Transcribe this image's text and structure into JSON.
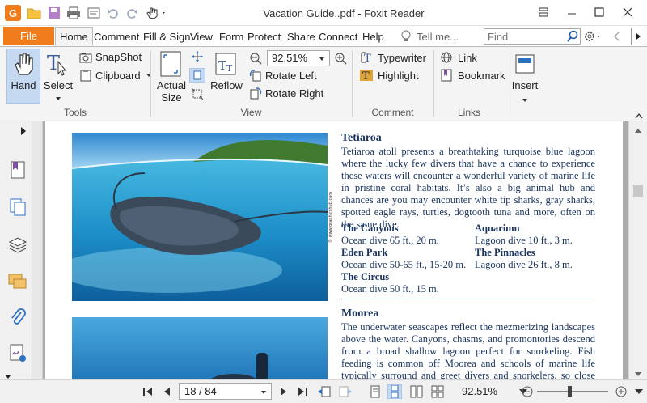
{
  "window": {
    "title": "Vacation Guide..pdf - Foxit Reader",
    "logo_letter": "G",
    "controls": [
      "restore-window",
      "minimize",
      "maximize",
      "close"
    ]
  },
  "ribbon_tabs": {
    "file": "File",
    "tabs": [
      "Home",
      "Comment",
      "Fill & Sign",
      "View",
      "Form",
      "Protect",
      "Share",
      "Connect",
      "Help"
    ],
    "active": "Home",
    "tell_me": "Tell me...",
    "find_placeholder": "Find"
  },
  "ribbon": {
    "tools": {
      "label": "Tools",
      "hand": "Hand",
      "select": "Select",
      "snapshot": "SnapShot",
      "clipboard": "Clipboard"
    },
    "view": {
      "label": "View",
      "actual_size_line1": "Actual",
      "actual_size_line2": "Size",
      "reflow": "Reflow",
      "zoom_value": "92.51%",
      "rotate_left": "Rotate Left",
      "rotate_right": "Rotate Right"
    },
    "comment": {
      "label": "Comment",
      "typewriter": "Typewriter",
      "highlight": "Highlight"
    },
    "links": {
      "label": "Links",
      "link": "Link",
      "bookmark": "Bookmark"
    },
    "insert": "Insert"
  },
  "document": {
    "photo_credit": "© www.graphicshub.com",
    "section1": {
      "title": "Tetiaroa",
      "body": "Tetiaroa atoll presents a breathtaking turquoise blue lagoon where the lucky few divers that have a chance to experience these waters will encounter a wonderful variety of marine life in pristine coral habitats. It’s also a big animal hub and chances are you may encounter white tip sharks, gray sharks, spotted eagle rays, turtles, dogtooth tuna and more, often on the same dive.",
      "sites": [
        {
          "name": "The Canyons",
          "detail": "Ocean dive 65 ft., 20 m."
        },
        {
          "name": "Eden Park",
          "detail": "Ocean dive 50-65 ft., 15-20 m."
        },
        {
          "name": "The Circus",
          "detail": "Ocean dive 50 ft., 15 m."
        },
        {
          "name": "Aquarium",
          "detail": "Lagoon dive 10 ft., 3 m."
        },
        {
          "name": "The Pinnacles",
          "detail": "Lagoon dive 26 ft., 8 m."
        }
      ]
    },
    "section2": {
      "title": "Moorea",
      "body": "The underwater seascapes reflect the mezmerizing landscapes above the water. Canyons, chasms, and promontories descend from a broad shallow lagoon perfect for snorkeling. Fish feeding is common off Moorea and schools of marine life typically surround and greet divers and snorkelers, so close encounters"
    }
  },
  "status": {
    "page": "18 / 84",
    "zoom": "92.51%",
    "zoom_level_fraction": 0.46
  }
}
